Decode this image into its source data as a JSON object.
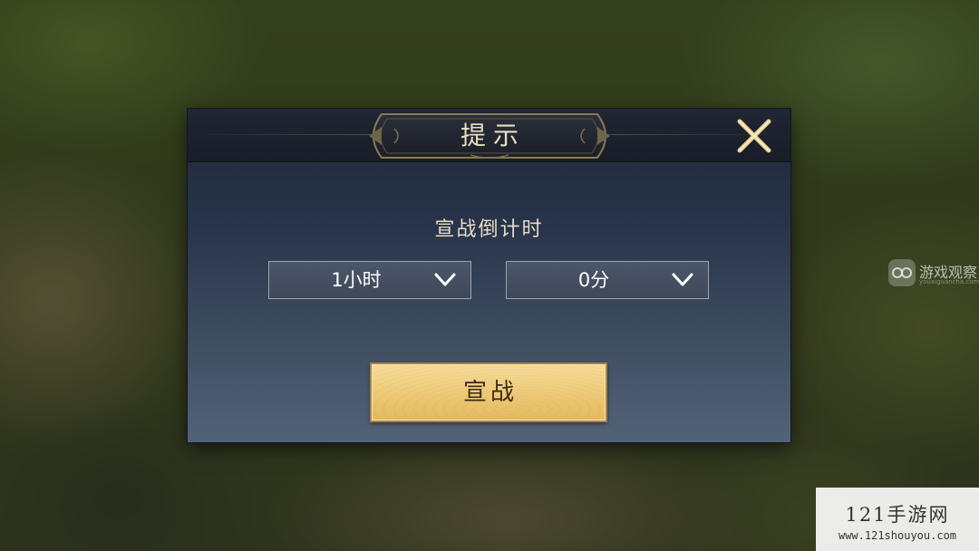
{
  "dialog": {
    "title": "提示",
    "countdown_label": "宣战倒计时",
    "hours_select": {
      "value": "1小时"
    },
    "minutes_select": {
      "value": "0分"
    },
    "declare_button": "宣战"
  },
  "icons": {
    "close": "close-x-icon",
    "dropdown": "chevron-down-icon"
  },
  "colors": {
    "title_text": "#e8ddc0",
    "button_gold": "#efcd7c",
    "dialog_bg": "#28344a"
  },
  "watermarks": {
    "observer_name": "游戏观察",
    "observer_sub": "youxiguancha.com",
    "site_name": "121手游网",
    "site_url": "www.121shouyou.com"
  }
}
